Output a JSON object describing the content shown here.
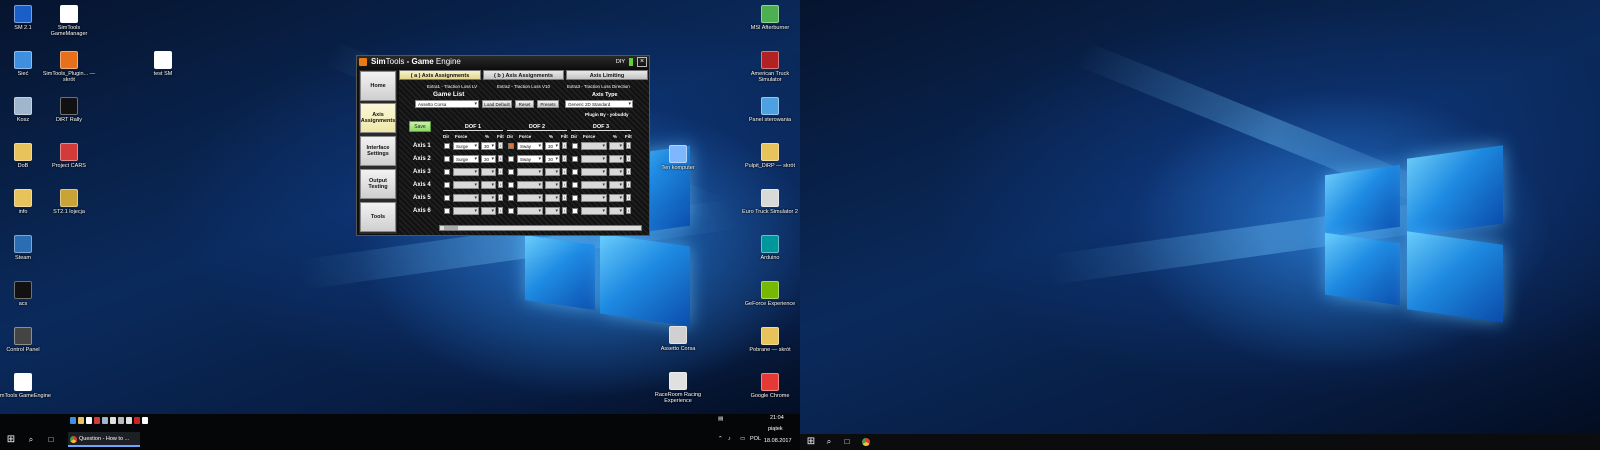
{
  "left_desktop": {
    "icons_left_column": [
      {
        "label": "SM 2.1",
        "icon": "blue-app-icon",
        "color": "#1a5fc7"
      },
      {
        "label": "Sieć",
        "icon": "network-globe-icon",
        "color": "#3f8fe0"
      },
      {
        "label": "Kosz",
        "icon": "recycle-bin-icon",
        "color": "#9fb6cc"
      },
      {
        "label": "DoB",
        "icon": "folder-icon",
        "color": "#e8c25a"
      },
      {
        "label": "info",
        "icon": "folder-icon",
        "color": "#e8c25a"
      },
      {
        "label": "Steam",
        "icon": "steam-icon",
        "color": "#2a6db2"
      },
      {
        "label": "acs",
        "icon": "console-icon",
        "color": "#111111"
      },
      {
        "label": "Control Panel",
        "icon": "steering-wheel-icon",
        "color": "#444444"
      },
      {
        "label": "SimTools GameEngine",
        "icon": "document-icon",
        "color": "#ffffff"
      }
    ],
    "icons_second_column": [
      {
        "label": "SimTools GameManager",
        "icon": "document-icon",
        "color": "#ffffff"
      },
      {
        "label": "SimTools_Plugin... — skrót",
        "icon": "simtools-plugin-icon",
        "color": "#e8701a"
      },
      {
        "label": "DiRT Rally",
        "icon": "dirt-rally-icon",
        "color": "#111111"
      },
      {
        "label": "Project CARS",
        "icon": "project-cars-icon",
        "color": "#d33b3b"
      },
      {
        "label": "ST2.1 lojecja",
        "icon": "archive-icon",
        "color": "#c9a336"
      }
    ],
    "icons_third_column": [
      {
        "label": "test SM",
        "icon": "text-file-icon",
        "color": "#ffffff"
      }
    ],
    "icons_right_column": [
      {
        "label": "MSI Afterburner",
        "icon": "msi-afterburner-icon",
        "color": "#4caf50"
      },
      {
        "label": "American Truck Simulator",
        "icon": "truck-icon",
        "color": "#b22222"
      },
      {
        "label": "Panel sterowania",
        "icon": "control-panel-icon",
        "color": "#4ea1e0"
      },
      {
        "label": "Pulpit_DiRP — skrót",
        "icon": "folder-shortcut-icon",
        "color": "#e8c25a"
      },
      {
        "label": "Euro Truck Simulator 2",
        "icon": "truck-icon",
        "color": "#d9d9d9"
      },
      {
        "label": "Arduino",
        "icon": "arduino-icon",
        "color": "#00979c"
      },
      {
        "label": "GeForce Experience",
        "icon": "geforce-icon",
        "color": "#76b900"
      },
      {
        "label": "Pobrane — skrót",
        "icon": "folder-shortcut-icon",
        "color": "#e8c25a"
      },
      {
        "label": "Google Chrome",
        "icon": "chrome-icon",
        "color": "#e53935"
      }
    ],
    "icons_center": [
      {
        "label": "Ten komputer",
        "icon": "computer-icon",
        "color": "#7fb7ff"
      },
      {
        "label": "Assetto Corsa",
        "icon": "assetto-corsa-icon",
        "color": "#d0d0d0"
      },
      {
        "label": "RaceRoom Racing Experience",
        "icon": "helmet-icon",
        "color": "#e0e0e0"
      }
    ],
    "taskbar": {
      "task_label": "Question - How to ...",
      "tray_lang": "POL",
      "time": "21:04",
      "day": "piątek",
      "date": "18.08.2017"
    }
  },
  "simtools": {
    "title_prefix": "Sim",
    "title_middle": "Tools",
    "title_suffix": " - Game",
    "title_end": " Engine",
    "dof_label": "DIY",
    "close_glyph": "×",
    "sidebar": [
      {
        "label": "Home",
        "active": false
      },
      {
        "label": "Axis Assignments",
        "active": true
      },
      {
        "label": "Interface Settings",
        "active": false
      },
      {
        "label": "Output Testing",
        "active": false
      },
      {
        "label": "Tools",
        "active": false
      }
    ],
    "tabs": [
      {
        "label": "( a ) Axis Assignments",
        "active": true
      },
      {
        "label": "( b ) Axis Assignments",
        "active": false
      },
      {
        "label": "Axis Limiting",
        "active": false
      }
    ],
    "extras": [
      "Extra1 - Traction Loss LV",
      "Extra2 - Traction Loss V10",
      "Extra3 - Traction Loss Direction"
    ],
    "game_list_header": "Game List",
    "axis_type_header": "Axis Type",
    "game_selected": "Assetto Corsa",
    "buttons": {
      "load_default": "Load Default",
      "reset": "Reset",
      "presets": "Presets"
    },
    "axis_type_selected": "Generic 2D Standard",
    "plugin_by": "Plugin By - yobuddy",
    "save_label": "Save",
    "dof_headers": [
      "DOF 1",
      "DOF 2",
      "DOF 3"
    ],
    "col_headers": {
      "dir": "Dir",
      "force": "Force",
      "pct": "%",
      "filt": "Filt"
    },
    "axes": [
      {
        "label": "Axis 1",
        "dof1": {
          "checked": false,
          "force": "Surge",
          "pct": "30"
        },
        "dof2": {
          "checked": true,
          "force": "Sway",
          "pct": "30"
        }
      },
      {
        "label": "Axis 2",
        "dof1": {
          "checked": false,
          "force": "Surge",
          "pct": "30"
        },
        "dof2": {
          "checked": false,
          "force": "Sway",
          "pct": "30"
        }
      },
      {
        "label": "Axis 3"
      },
      {
        "label": "Axis 4"
      },
      {
        "label": "Axis 5"
      },
      {
        "label": "Axis 6"
      }
    ],
    "colors": {
      "accent_orange": "#e87b12",
      "active_tab": "#f7f2cf",
      "save_green": "#8fd86a"
    }
  }
}
